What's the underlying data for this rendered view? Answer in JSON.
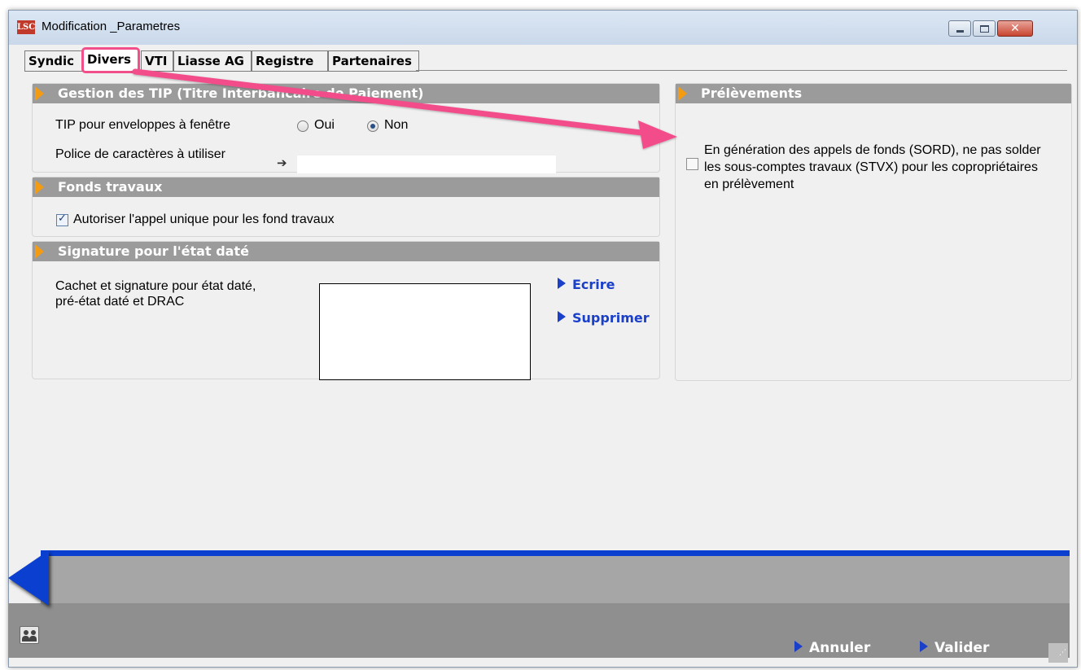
{
  "window": {
    "title": "Modification _Parametres",
    "logo": "LSC",
    "close_glyph": "✕"
  },
  "tabs": [
    "Syndic",
    "Divers",
    "VTI",
    "Liasse AG",
    "Registre",
    "Partenaires"
  ],
  "tip": {
    "header": "Gestion des TIP (Titre Interbancaire de Paiement)",
    "envelope_label": "TIP pour enveloppes à fenêtre",
    "radio_oui": "Oui",
    "radio_non": "Non",
    "selected": "Non",
    "font_label": "Police de caractères à utiliser",
    "font_value": ""
  },
  "fonds": {
    "header": "Fonds travaux",
    "checkbox_label": "Autoriser l'appel unique pour les fond travaux",
    "checked": true
  },
  "signature": {
    "header": "Signature pour l'état daté",
    "label_line1": "Cachet et signature pour état daté,",
    "label_line2": "pré-état daté et DRAC",
    "write_label": "Ecrire",
    "delete_label": "Supprimer"
  },
  "prelevements": {
    "header": "Prélèvements",
    "text": "En génération des appels de fonds (SORD), ne pas solder les sous-comptes travaux (STVX) pour les copropriétaires en prélèvement",
    "checked": false
  },
  "footer": {
    "cancel_label": "Annuler",
    "validate_label": "Valider"
  },
  "colors": {
    "accent_pink": "#f24e8a",
    "link_blue": "#1a3fc8",
    "chevron_orange": "#f39c12",
    "section_gray": "#9b9b9b"
  }
}
